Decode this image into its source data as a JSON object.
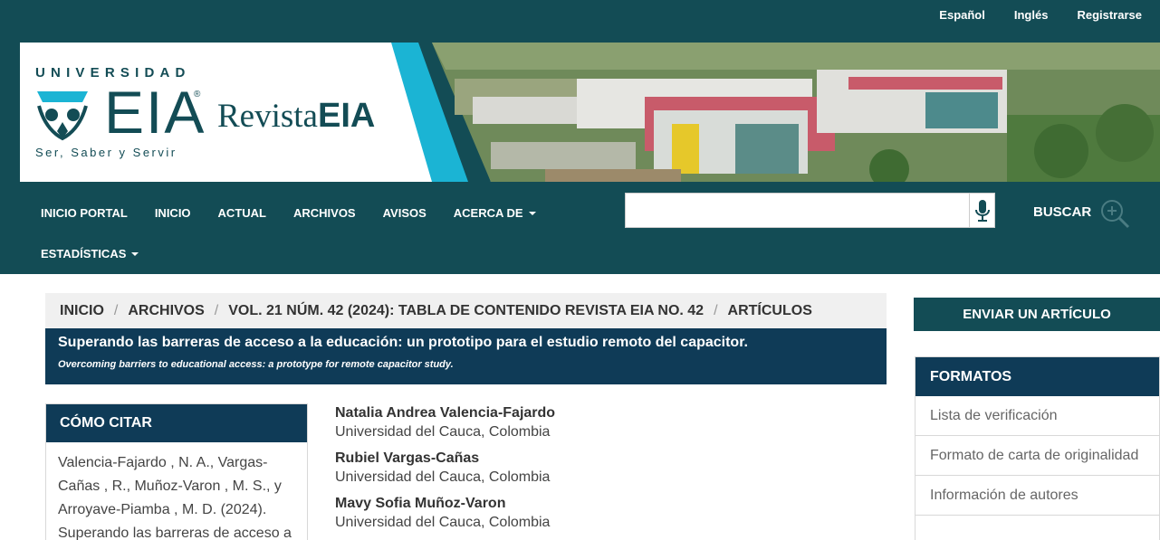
{
  "top_links": [
    "Español",
    "Inglés",
    "Registrarse"
  ],
  "logo": {
    "university": "UNIVERSIDAD",
    "name": "EIA",
    "registered": "®",
    "slogan": "Ser, Saber y Servir",
    "journal_prefix": "Revista",
    "journal_suffix": "EIA"
  },
  "nav": {
    "items": [
      "INICIO PORTAL",
      "INICIO",
      "ACTUAL",
      "ARCHIVOS",
      "AVISOS",
      "ACERCA DE"
    ],
    "second_row": [
      "ESTADÍSTICAS"
    ]
  },
  "search": {
    "placeholder": "",
    "button_label": "BUSCAR"
  },
  "breadcrumb": [
    "INICIO",
    "ARCHIVOS",
    "VOL. 21 NÚM. 42 (2024): TABLA DE CONTENIDO REVISTA EIA NO. 42",
    "ARTÍCULOS"
  ],
  "article": {
    "title": "Superando las barreras de acceso a la educación: un prototipo para el estudio remoto del capacitor.",
    "subtitle": "Overcoming barriers to educational access: a prototype for remote capacitor study."
  },
  "cite": {
    "heading": "CÓMO CITAR",
    "text": "Valencia-Fajardo , N. A., Vargas-Cañas , R., Muñoz-Varon , M. S., y Arroyave-Piamba , M. D. (2024). Superando las barreras de acceso a"
  },
  "authors": [
    {
      "name": "Natalia Andrea Valencia-Fajardo",
      "affiliation": "Universidad del Cauca, Colombia"
    },
    {
      "name": "Rubiel Vargas-Cañas",
      "affiliation": "Universidad del Cauca, Colombia"
    },
    {
      "name": "Mavy Sofia Muñoz-Varon",
      "affiliation": "Universidad del Cauca, Colombia"
    }
  ],
  "sidebar": {
    "submit_label": "ENVIAR UN ARTÍCULO",
    "formats_heading": "FORMATOS",
    "formats": [
      "Lista de verificación",
      "Formato de carta de originalidad",
      "Información de autores"
    ]
  },
  "colors": {
    "header_bg": "#134c55",
    "title_bg": "#0f3b57",
    "accent": "#1bb4d4"
  }
}
